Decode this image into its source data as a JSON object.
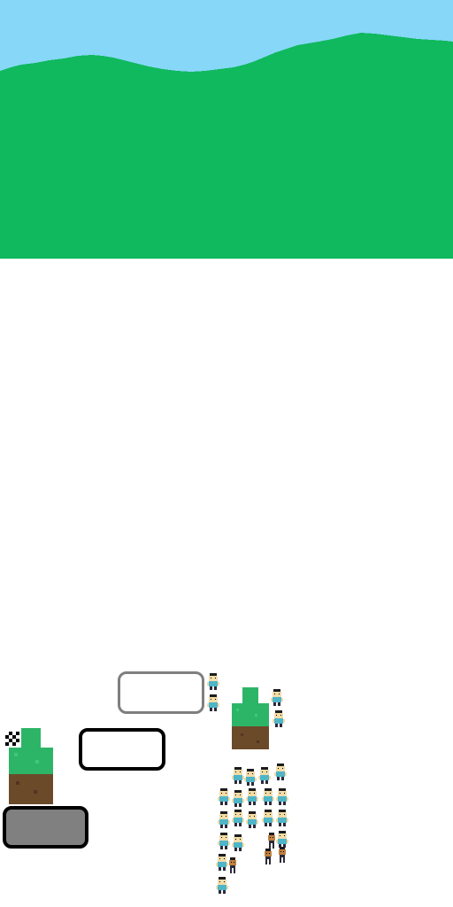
{
  "colors": {
    "sky": "#87d7f9",
    "hill": "#10b95d",
    "grass": "#2db567",
    "grass_light": "#3cc97b",
    "dirt": "#6b4a2a",
    "dirt_dark": "#513520",
    "panel_fill": "#808080",
    "panel_border_dark": "#000000",
    "panel_border_light": "#7f7f7f",
    "villager_shirt": "#4fb5c8",
    "villager_skin": "#f2dca8",
    "villager_hair": "#1c1c1c",
    "villager_pants": "#2a2a3a"
  },
  "icons": {
    "checkered_flag": "checkered-flag-icon",
    "grass_block": "grass-block-icon",
    "villager": "villager-icon",
    "totem": "totem-icon"
  }
}
